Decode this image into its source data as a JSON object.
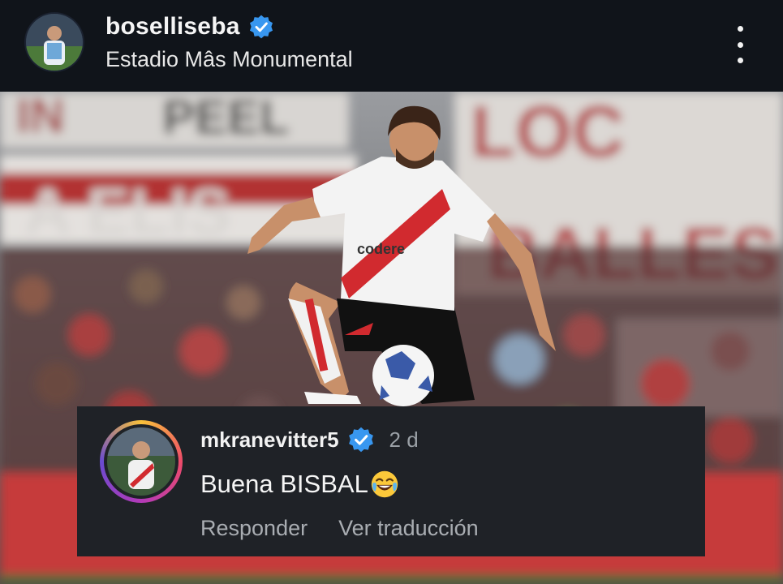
{
  "post": {
    "username": "boselliseba",
    "verified": true,
    "location": "Estadio Mâs Monumental",
    "menu_icon": "more-vertical-icon"
  },
  "photo": {
    "subject": "football player in white jersey with red sash controlling a ball in a stadium",
    "shirt_sponsor": "codere"
  },
  "comment": {
    "username": "mkranevitter5",
    "verified": true,
    "time": "2 d",
    "text": "Buena BISBAL",
    "emoji": "laughing-with-tears-emoji",
    "actions": {
      "reply": "Responder",
      "translate": "Ver traducción"
    }
  },
  "colors": {
    "background": "#10141a",
    "verified_blue": "#3897f0",
    "comment_bg": "#1f2227",
    "river_red": "#d12a2f"
  }
}
